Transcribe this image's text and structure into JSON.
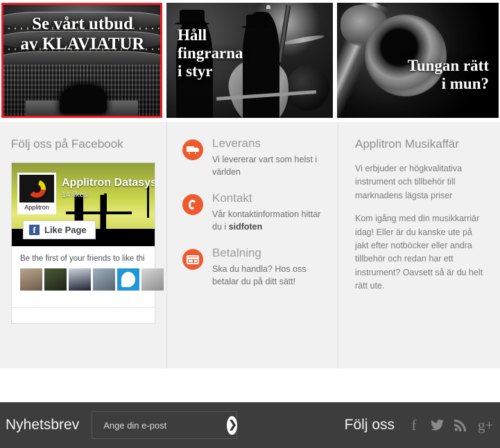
{
  "banners": [
    {
      "caption": "Se vårt utbud\nav KLAVIATUR",
      "line1": "Se vårt utbud",
      "line2": "av KLAVIATUR",
      "image": "concert-hall-piano",
      "selected": true,
      "border_color": "#ee1c25"
    },
    {
      "line1": "Håll",
      "line2": "fingrarna",
      "line3": "i styr",
      "image": "jazz-band-double-bass",
      "selected": false
    },
    {
      "line1": "Tungan rätt",
      "line2": "i mun?",
      "image": "trombone-close-up",
      "selected": false
    }
  ],
  "facebook": {
    "heading": "Följ oss på Facebook",
    "page_name": "Applitron Datasyst",
    "likes": "14 likes",
    "logo_label": "Applitron",
    "like_button": "Like Page",
    "friends_text": "Be the first of your friends to like thi",
    "avatar_count": 6
  },
  "features": {
    "items": [
      {
        "icon": "truck-icon",
        "title": "Leverans",
        "desc": "Vi levererar vart som helst i världen"
      },
      {
        "icon": "phone-icon",
        "title": "Kontakt",
        "desc_pre": "Vår kontaktinformation hittar du i ",
        "desc_bold": "sidfoten"
      },
      {
        "icon": "credit-card-icon",
        "title": "Betalning",
        "desc": "Ska du handla? Hos oss betalar du på ditt sätt!"
      }
    ]
  },
  "about": {
    "heading": "Applitron Musikaffär",
    "paragraph1": "Vi erbjuder er högkvalitativa instrument och tillbehör till marknadens lägsta priser",
    "paragraph2": "Kom igång med din musikkarriär idag! Eller är du kanske ute på jakt efter notböcker eller andra tillbehör och redan har ett instrument? Oavsett så är du helt rätt ute."
  },
  "footer": {
    "newsletter_label": "Nyhetsbrev",
    "email_placeholder": "Ange din e-post",
    "email_value": "",
    "submit_icon": "chevron-right-icon",
    "follow_label": "Följ oss",
    "social": [
      {
        "name": "facebook-icon",
        "glyph": "f"
      },
      {
        "name": "twitter-icon",
        "glyph": "t"
      },
      {
        "name": "rss-icon",
        "glyph": "r"
      },
      {
        "name": "google-plus-icon",
        "glyph": "g+"
      }
    ]
  },
  "colors": {
    "accent_orange": "#ee5a2e",
    "selected_border": "#ee1c25",
    "panel_bg": "#f1f1f1",
    "footer_bg": "#3d3d3d"
  }
}
